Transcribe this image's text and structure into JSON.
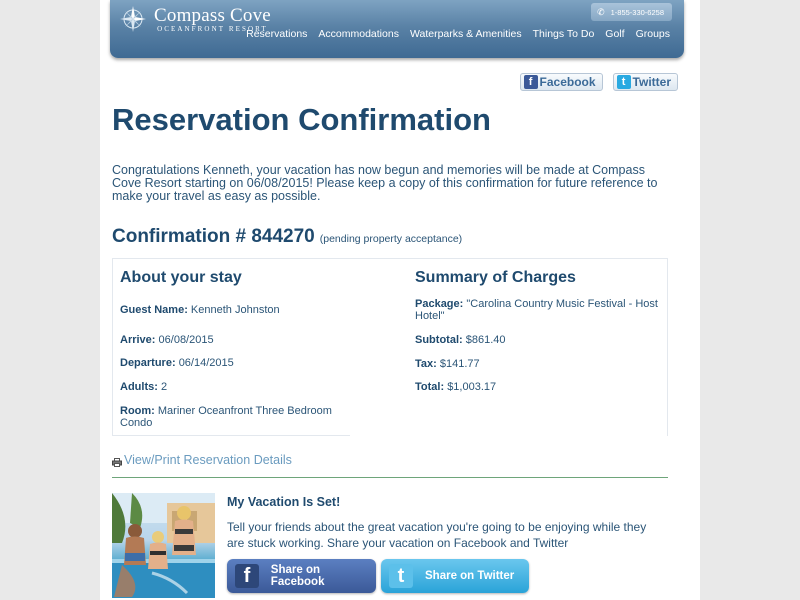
{
  "header": {
    "logo_name": "Compass Cove",
    "logo_sub": "OCEANFRONT RESORT",
    "phone": "1-855-330-6258",
    "nav": [
      "Reservations",
      "Accommodations",
      "Waterparks & Amenities",
      "Things To Do",
      "Golf",
      "Groups"
    ]
  },
  "social_top": {
    "facebook": "Facebook",
    "twitter": "Twitter"
  },
  "page_title": "Reservation Confirmation",
  "intro": "Congratulations Kenneth, your vacation has now begun and memories will be made at Compass Cove Resort starting on 06/08/2015! Please keep a copy of this confirmation for future reference to make your travel as easy as possible.",
  "confirmation": {
    "title": "Confirmation # 844270",
    "note": "(pending property acceptance)"
  },
  "stay": {
    "heading": "About your stay",
    "guest_label": "Guest Name:",
    "guest": "Kenneth Johnston",
    "arrive_label": "Arrive:",
    "arrive": "06/08/2015",
    "departure_label": "Departure:",
    "departure": "06/14/2015",
    "adults_label": "Adults:",
    "adults": "2",
    "room_label": "Room:",
    "room": "Mariner Oceanfront Three Bedroom Condo"
  },
  "charges": {
    "heading": "Summary of Charges",
    "package_label": "Package:",
    "package": "\"Carolina Country Music Festival - Host Hotel\"",
    "subtotal_label": "Subtotal:",
    "subtotal": "$861.40",
    "tax_label": "Tax:",
    "tax": "$141.77",
    "total_label": "Total:",
    "total": "$1,003.17"
  },
  "view_link": "View/Print Reservation Details",
  "vacation": {
    "title": "My Vacation Is Set!",
    "text": "Tell your friends about the great vacation you're going to be enjoying while they are stuck working. Share your vacation on Facebook and Twitter",
    "share_facebook": "Share on Facebook",
    "share_twitter": "Share on Twitter"
  },
  "colors": {
    "brand": "#1f4a6e",
    "link": "#6a9bbf",
    "facebook": "#3b5998",
    "twitter": "#29a9e1",
    "divider": "#6ea57a"
  },
  "icons": [
    "compass-logo-icon",
    "phone-icon",
    "facebook-icon",
    "twitter-icon",
    "printer-icon"
  ]
}
